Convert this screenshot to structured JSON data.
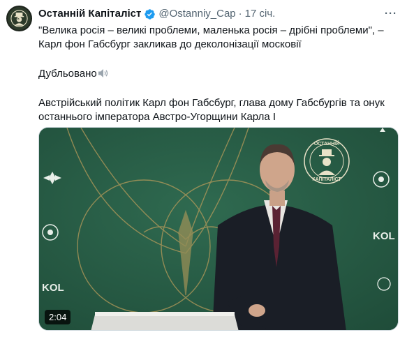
{
  "tweet": {
    "display_name": "Останній Капіталіст",
    "handle": "@Ostanniy_Cap",
    "separator": "·",
    "time": "17 січ.",
    "more_label": "···",
    "quote_line": "\"Велика росія – великі проблеми, маленька росія – дрібні проблеми\", – Карл фон Габсбург закликав до деколонізації московії",
    "dubbed_label": "Дубльовано",
    "description": "Австрійський політик Карл фон Габсбург, глава дому Габсбургів та онук останнього імператора Австро-Угорщини Карла I",
    "icons": {
      "avatar": "capitalist-logo-avatar",
      "verified": "verified-badge-icon",
      "speaker": "speaker-icon"
    },
    "colors": {
      "verified": "#1d9bf0",
      "secondary_text": "#536471",
      "video_background": "#275c45"
    }
  },
  "video": {
    "duration": "2:04",
    "logo_top_text": "ОСТАННІЙ",
    "logo_bottom_text": "КАПІТАЛІСТ",
    "side_logo_text": "KOL"
  }
}
